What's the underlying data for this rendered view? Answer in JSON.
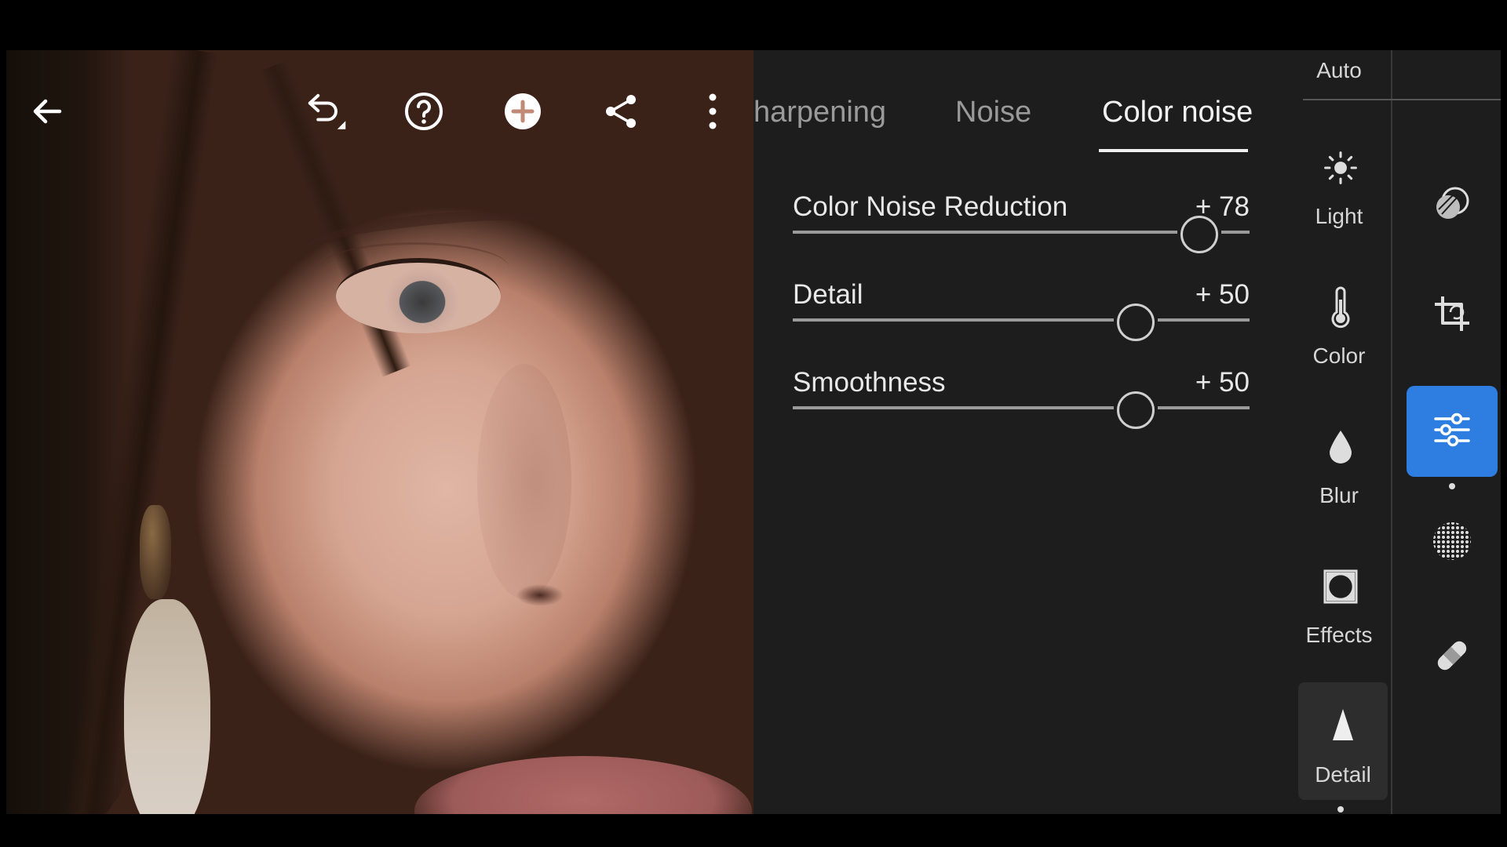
{
  "toolbar": {
    "back_icon": "back-arrow-icon",
    "undo_icon": "undo-icon",
    "help_icon": "help-icon",
    "add_icon": "add-icon",
    "share_icon": "share-icon",
    "more_icon": "more-vertical-icon"
  },
  "tabs": [
    {
      "label": "Sharpening",
      "visible_label": "harpening",
      "active": false
    },
    {
      "label": "Noise",
      "active": false
    },
    {
      "label": "Color noise",
      "active": true
    }
  ],
  "sliders": [
    {
      "label": "Color Noise Reduction",
      "value": "+ 78",
      "level": 78
    },
    {
      "label": "Detail",
      "value": "+ 50",
      "level": 50
    },
    {
      "label": "Smoothness",
      "value": "+ 50",
      "level": 50
    }
  ],
  "categories": {
    "auto_label": "Auto",
    "items": [
      {
        "label": "Light",
        "icon": "sun-icon"
      },
      {
        "label": "Color",
        "icon": "thermometer-icon"
      },
      {
        "label": "Blur",
        "icon": "droplet-icon"
      },
      {
        "label": "Effects",
        "icon": "vignette-icon"
      },
      {
        "label": "Detail",
        "icon": "triangle-icon",
        "active": true
      }
    ]
  },
  "rail": {
    "items": [
      {
        "icon": "presets-icon"
      },
      {
        "icon": "crop-icon"
      },
      {
        "icon": "adjust-sliders-icon",
        "active": true
      },
      {
        "icon": "masking-icon"
      },
      {
        "icon": "healing-bandage-icon"
      }
    ]
  },
  "colors": {
    "accent": "#2d7ee0",
    "panel_bg": "#1d1d1d"
  }
}
